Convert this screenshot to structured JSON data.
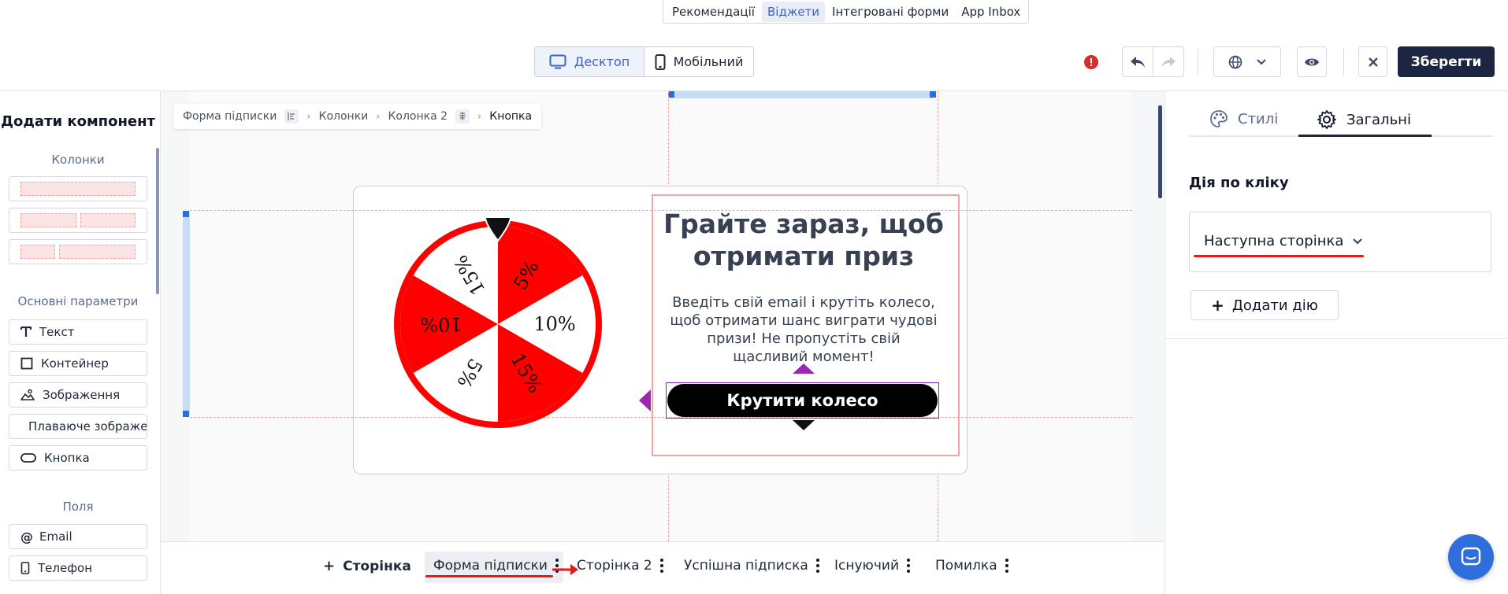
{
  "section_tabs": [
    "Рекомендації",
    "Віджети",
    "Інтегровані форми",
    "App Inbox"
  ],
  "toolbar": {
    "desktop_label": "Десктоп",
    "mobile_label": "Мобільний",
    "save_label": "Зберегти"
  },
  "sidebar": {
    "title": "Додати компонент",
    "columns_label": "Колонки",
    "basic_label": "Основні параметри",
    "basic_items": [
      "Текст",
      "Контейнер",
      "Зображення",
      "Плаваюче зображення",
      "Кнопка"
    ],
    "fields_label": "Поля",
    "field_items": [
      "Email",
      "Телефон"
    ]
  },
  "breadcrumb": [
    "Форма підписки",
    "Колонки",
    "Колонка 2",
    "Кнопка"
  ],
  "popup": {
    "headline": "Грайте зараз, щоб отримати приз",
    "description": "Введіть свій email і крутіть колесо, щоб отримати шанс виграти чудові призи! Не пропустіть свій щасливий момент!",
    "cta": "Крутити колесо",
    "wheel": {
      "segments": [
        "5%",
        "10%",
        "15%",
        "5%",
        "10%",
        "15%"
      ],
      "colors": [
        "#ff0000",
        "#ffffff",
        "#ff0000",
        "#ffffff",
        "#ff0000",
        "#ffffff"
      ],
      "rim_color": "#ff0000"
    }
  },
  "right_panel": {
    "tab_styles": "Стилі",
    "tab_general": "Загальні",
    "action_label": "Дія по кліку",
    "action_value": "Наступна сторінка",
    "add_action": "Додати дію"
  },
  "pages": {
    "add_label": "Сторінка",
    "items": [
      "Форма підписки",
      "Сторінка 2",
      "Успішна підписка",
      "Існуючий",
      "Помилка"
    ]
  },
  "colors": {
    "accent": "#3a63c8",
    "save_bg": "#1c2541",
    "warning": "#d32f2f",
    "selection": "#8b1fa9",
    "annotation_red": "#e21b1b"
  }
}
